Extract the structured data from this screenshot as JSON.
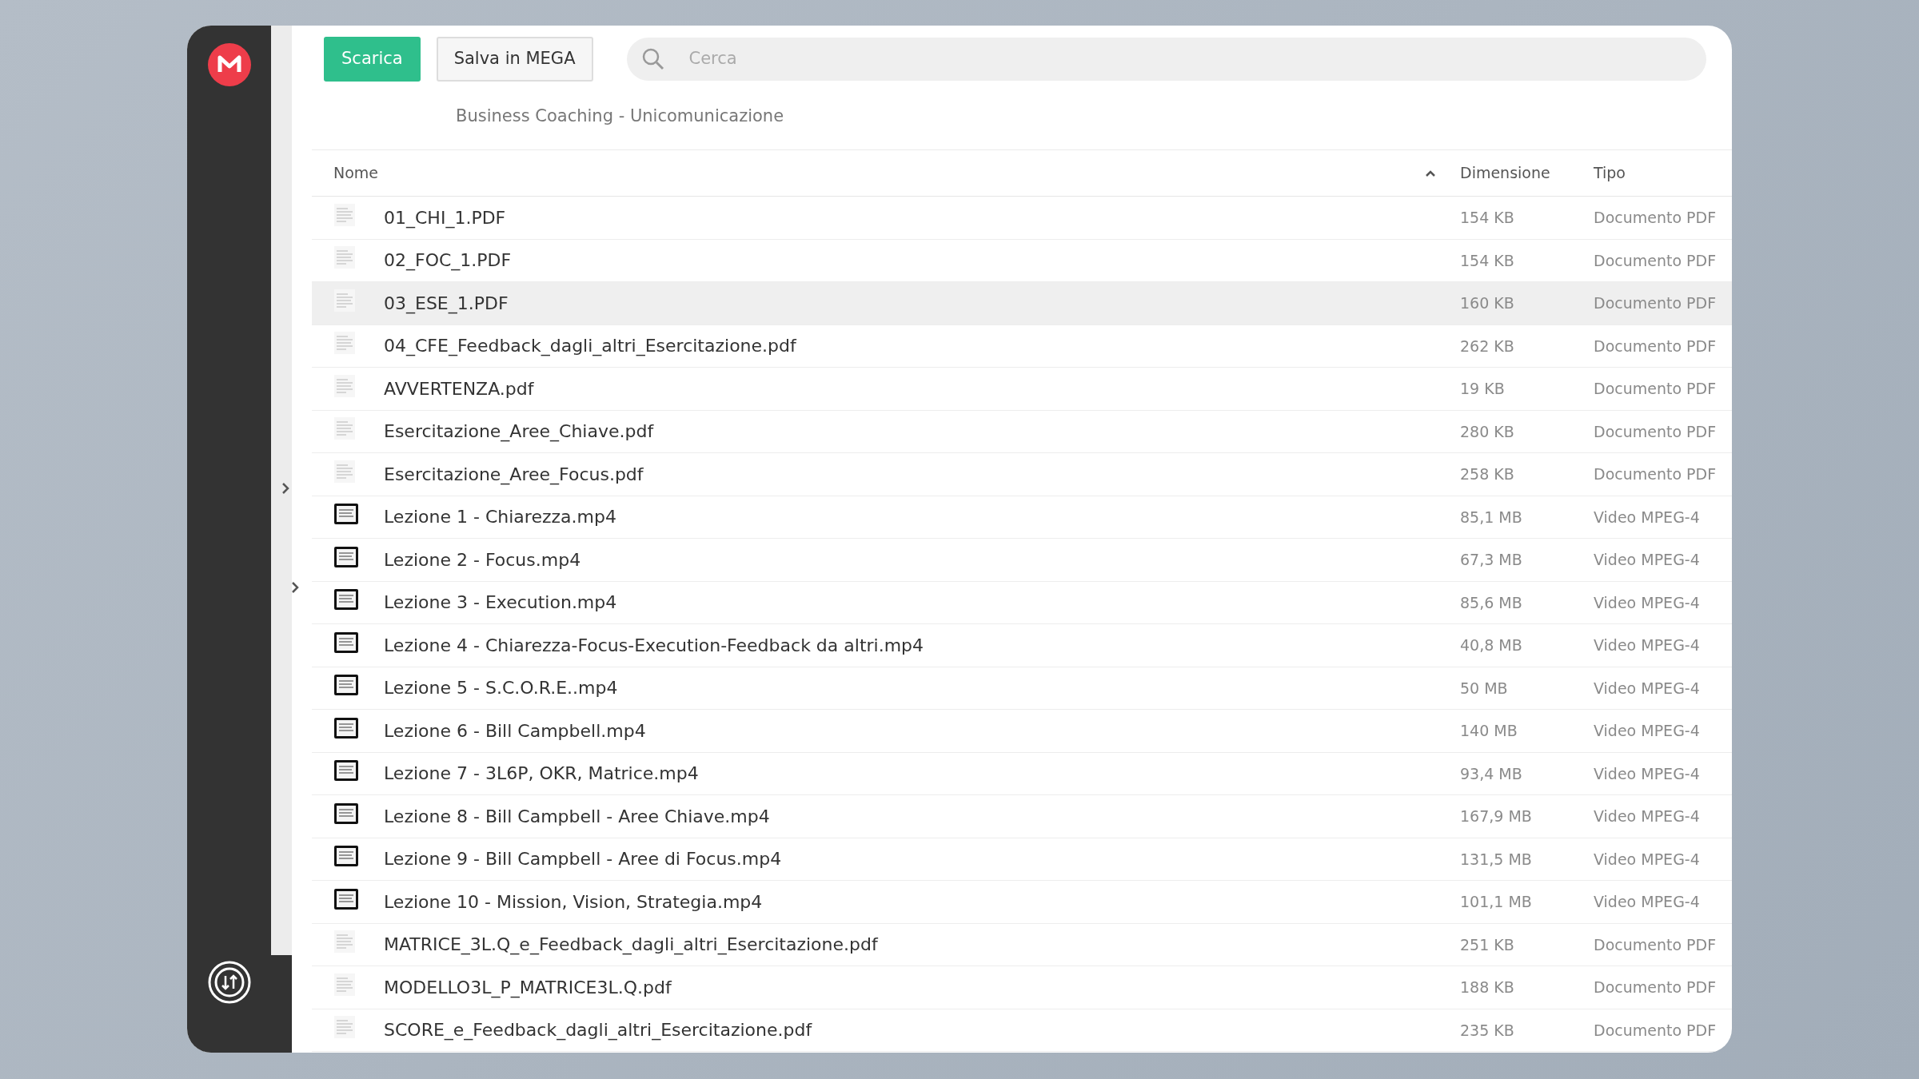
{
  "toolbar": {
    "download_button": "Scarica",
    "save_button": "Salva in MEGA",
    "search": {
      "placeholder": "Cerca"
    }
  },
  "breadcrumb": "Business Coaching - Unicomunicazione",
  "table": {
    "columns": [
      {
        "label": "Nome",
        "sorted": true
      },
      {
        "label": "Dimensione",
        "sorted": false
      },
      {
        "label": "Tipo",
        "sorted": false
      }
    ],
    "rows": [
      {
        "kind": "pdf",
        "name": "01_CHI_1.PDF",
        "size": "154 KB",
        "type": "Documento PDF",
        "highlighted": false
      },
      {
        "kind": "pdf",
        "name": "02_FOC_1.PDF",
        "size": "154 KB",
        "type": "Documento PDF",
        "highlighted": false
      },
      {
        "kind": "pdf",
        "name": "03_ESE_1.PDF",
        "size": "160 KB",
        "type": "Documento PDF",
        "highlighted": true
      },
      {
        "kind": "pdf",
        "name": "04_CFE_Feedback_dagli_altri_Esercitazione.pdf",
        "size": "262 KB",
        "type": "Documento PDF",
        "highlighted": false
      },
      {
        "kind": "pdf",
        "name": "AVVERTENZA.pdf",
        "size": "19 KB",
        "type": "Documento PDF",
        "highlighted": false
      },
      {
        "kind": "pdf",
        "name": "Esercitazione_Aree_Chiave.pdf",
        "size": "280 KB",
        "type": "Documento PDF",
        "highlighted": false
      },
      {
        "kind": "pdf",
        "name": "Esercitazione_Aree_Focus.pdf",
        "size": "258 KB",
        "type": "Documento PDF",
        "highlighted": false
      },
      {
        "kind": "video",
        "name": "Lezione 1 - Chiarezza.mp4",
        "size": "85,1 MB",
        "type": "Video MPEG-4",
        "highlighted": false
      },
      {
        "kind": "video",
        "name": "Lezione 2 - Focus.mp4",
        "size": "67,3 MB",
        "type": "Video MPEG-4",
        "highlighted": false
      },
      {
        "kind": "video",
        "name": "Lezione 3 - Execution.mp4",
        "size": "85,6 MB",
        "type": "Video MPEG-4",
        "highlighted": false
      },
      {
        "kind": "video",
        "name": "Lezione 4 - Chiarezza-Focus-Execution-Feedback da altri.mp4",
        "size": "40,8 MB",
        "type": "Video MPEG-4",
        "highlighted": false
      },
      {
        "kind": "video",
        "name": "Lezione 5 - S.C.O.R.E..mp4",
        "size": "50 MB",
        "type": "Video MPEG-4",
        "highlighted": false
      },
      {
        "kind": "video",
        "name": "Lezione 6 - Bill Campbell.mp4",
        "size": "140 MB",
        "type": "Video MPEG-4",
        "highlighted": false
      },
      {
        "kind": "video",
        "name": "Lezione 7 - 3L6P, OKR, Matrice.mp4",
        "size": "93,4 MB",
        "type": "Video MPEG-4",
        "highlighted": false
      },
      {
        "kind": "video",
        "name": "Lezione 8 - Bill Campbell - Aree Chiave.mp4",
        "size": "167,9 MB",
        "type": "Video MPEG-4",
        "highlighted": false
      },
      {
        "kind": "video",
        "name": "Lezione 9 - Bill Campbell - Aree di Focus.mp4",
        "size": "131,5 MB",
        "type": "Video MPEG-4",
        "highlighted": false
      },
      {
        "kind": "video",
        "name": "Lezione 10 - Mission, Vision, Strategia.mp4",
        "size": "101,1 MB",
        "type": "Video MPEG-4",
        "highlighted": false
      },
      {
        "kind": "pdf",
        "name": "MATRICE_3L.Q_e_Feedback_dagli_altri_Esercitazione.pdf",
        "size": "251 KB",
        "type": "Documento PDF",
        "highlighted": false
      },
      {
        "kind": "pdf",
        "name": "MODELLO3L_P_MATRICE3L.Q.pdf",
        "size": "188 KB",
        "type": "Documento PDF",
        "highlighted": false
      },
      {
        "kind": "pdf",
        "name": "SCORE_e_Feedback_dagli_altri_Esercitazione.pdf",
        "size": "235 KB",
        "type": "Documento PDF",
        "highlighted": false
      }
    ]
  }
}
